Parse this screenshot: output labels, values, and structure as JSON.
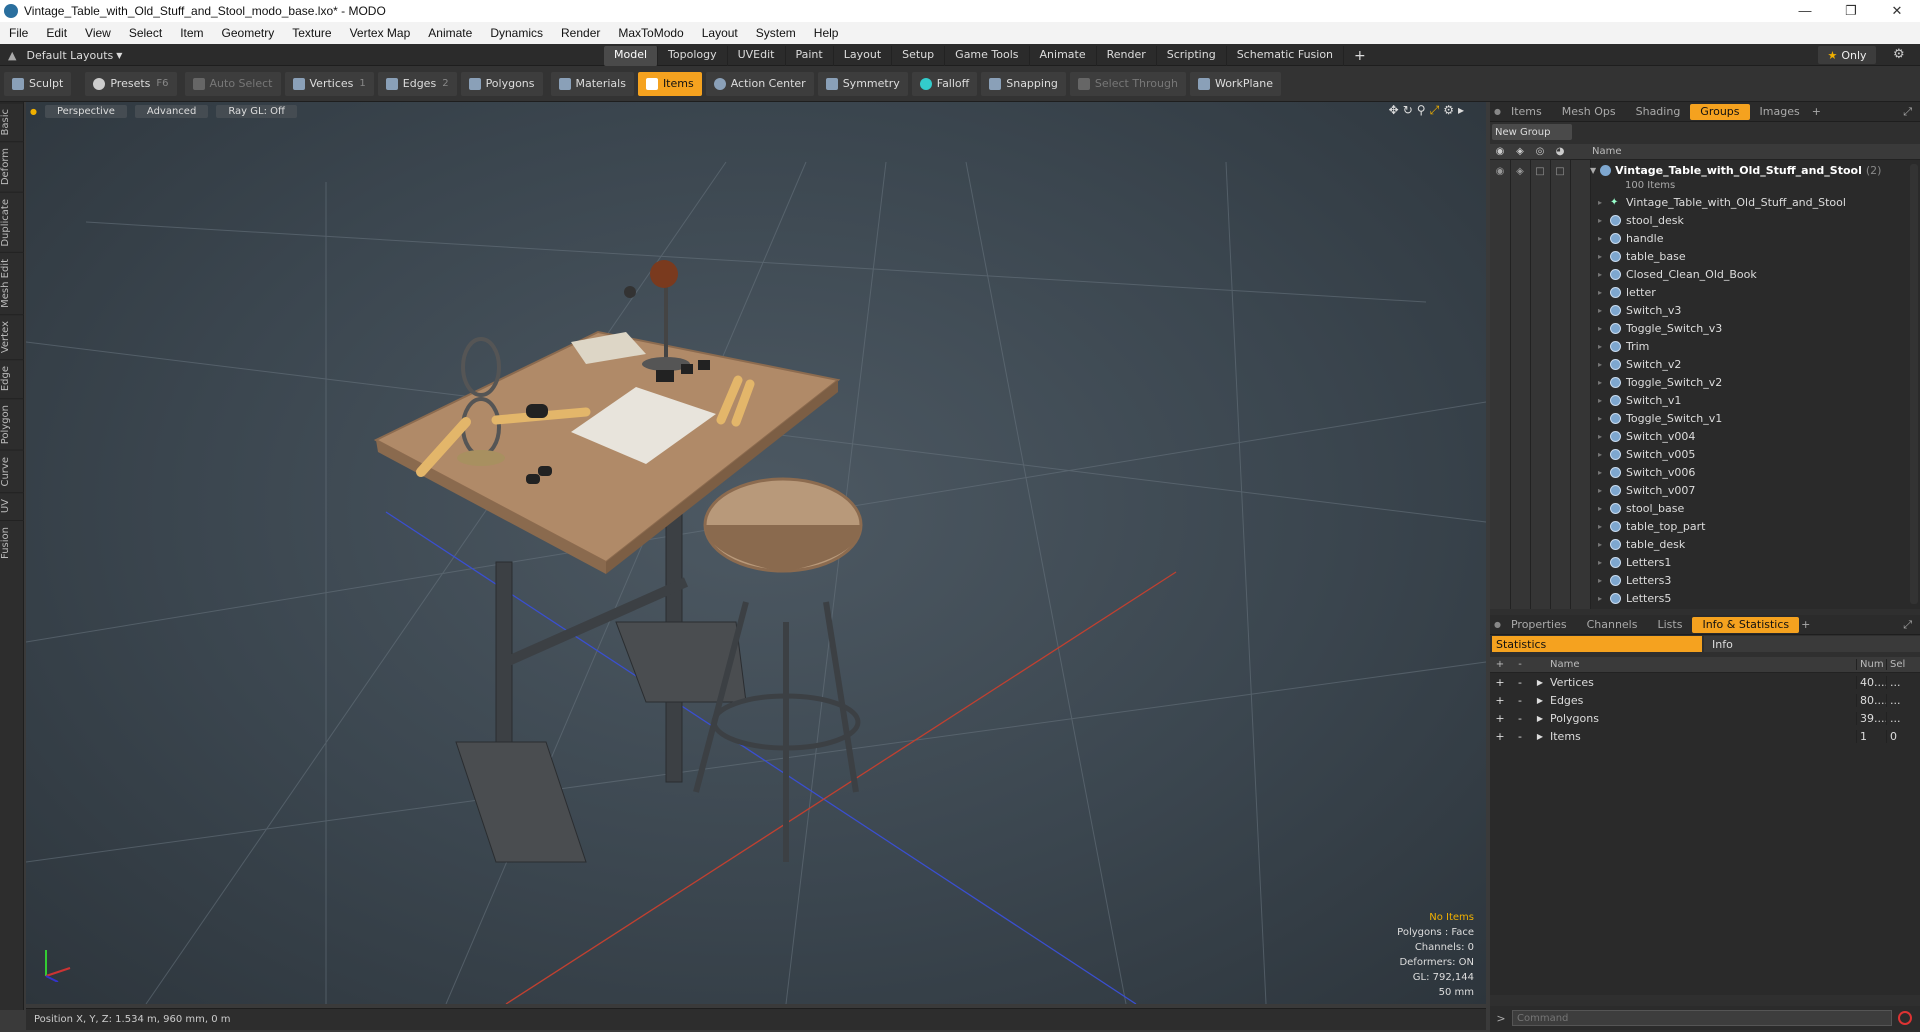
{
  "window": {
    "title": "Vintage_Table_with_Old_Stuff_and_Stool_modo_base.lxo* - MODO"
  },
  "menu": [
    "File",
    "Edit",
    "View",
    "Select",
    "Item",
    "Geometry",
    "Texture",
    "Vertex Map",
    "Animate",
    "Dynamics",
    "Render",
    "MaxToModo",
    "Layout",
    "System",
    "Help"
  ],
  "layout": {
    "selector": "Default Layouts",
    "tabs": [
      "Model",
      "Topology",
      "UVEdit",
      "Paint",
      "Layout",
      "Setup",
      "Game Tools",
      "Animate",
      "Render",
      "Scripting",
      "Schematic Fusion"
    ],
    "active_tab": "Model",
    "only_label": "Only"
  },
  "toolbar": {
    "sculpt": "Sculpt",
    "presets": "Presets",
    "presets_key": "F6",
    "auto_select": "Auto Select",
    "vertices": "Vertices",
    "vertices_count": "1",
    "edges": "Edges",
    "edges_count": "2",
    "polygons": "Polygons",
    "materials": "Materials",
    "items": "Items",
    "action_center": "Action Center",
    "symmetry": "Symmetry",
    "falloff": "Falloff",
    "snapping": "Snapping",
    "select_through": "Select Through",
    "workplane": "WorkPlane"
  },
  "left_tabs": [
    "Basic",
    "Deform",
    "Duplicate",
    "Mesh Edit",
    "Vertex",
    "Edge",
    "Polygon",
    "Curve",
    "UV",
    "Fusion"
  ],
  "viewport": {
    "view": "Perspective",
    "shading": "Advanced",
    "raygl": "Ray GL: Off",
    "hud": {
      "selection": "No Items",
      "polygons": "Polygons : Face",
      "channels": "Channels: 0",
      "deformers": "Deformers: ON",
      "gl": "GL: 792,144",
      "distance": "50 mm"
    }
  },
  "status": {
    "position": "Position X, Y, Z:  1.534 m, 960 mm, 0 m"
  },
  "top_panel": {
    "tabs": [
      "Items",
      "Mesh Ops",
      "Shading",
      "Groups",
      "Images"
    ],
    "active_tab": "Groups",
    "new_group": "New Group",
    "col_name": "Name",
    "root_name": "Vintage_Table_with_Old_Stuff_and_Stool",
    "root_count": "(2)",
    "root_sub": "100 Items",
    "items": [
      "Vintage_Table_with_Old_Stuff_and_Stool",
      "stool_desk",
      "handle",
      "table_base",
      "Closed_Clean_Old_Book",
      "letter",
      "Switch_v3",
      "Toggle_Switch_v3",
      "Trim",
      "Switch_v2",
      "Toggle_Switch_v2",
      "Switch_v1",
      "Toggle_Switch_v1",
      "Switch_v004",
      "Switch_v005",
      "Switch_v006",
      "Switch_v007",
      "stool_base",
      "table_top_part",
      "table_desk",
      "Letters1",
      "Letters3",
      "Letters5"
    ]
  },
  "bottom_panel": {
    "tabs": [
      "Properties",
      "Channels",
      "Lists",
      "Info & Statistics"
    ],
    "active_tab": "Info & Statistics",
    "sub_tabs": [
      "Statistics",
      "Info"
    ],
    "headers": {
      "name": "Name",
      "num": "Num",
      "sel": "Sel"
    },
    "rows": [
      {
        "name": "Vertices",
        "num": "40....",
        "sel": "..."
      },
      {
        "name": "Edges",
        "num": "80....",
        "sel": "..."
      },
      {
        "name": "Polygons",
        "num": "39....",
        "sel": "..."
      },
      {
        "name": "Items",
        "num": "1",
        "sel": "0"
      }
    ]
  },
  "command": {
    "placeholder": "Command"
  },
  "colors": {
    "accent": "#f5a21f",
    "viewport_bg": "#3b464f",
    "panel_bg": "#2f2f2f"
  }
}
